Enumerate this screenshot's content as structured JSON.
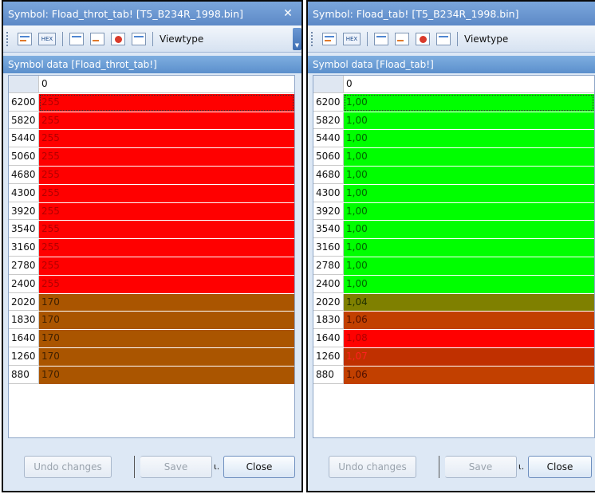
{
  "left": {
    "title": "Symbol: Fload_throt_tab! [T5_B234R_1998.bin]",
    "close_glyph": "✕",
    "viewtype_label": "Viewtype",
    "panel_header": "Symbol data [Fload_throt_tab!]",
    "column_header": "0",
    "rows": [
      {
        "label": "6200",
        "value": "255",
        "bg": "#ff0000",
        "fg": "#b30000"
      },
      {
        "label": "5820",
        "value": "255",
        "bg": "#ff0000",
        "fg": "#b30000"
      },
      {
        "label": "5440",
        "value": "255",
        "bg": "#ff0000",
        "fg": "#b30000"
      },
      {
        "label": "5060",
        "value": "255",
        "bg": "#ff0000",
        "fg": "#b30000"
      },
      {
        "label": "4680",
        "value": "255",
        "bg": "#ff0000",
        "fg": "#b30000"
      },
      {
        "label": "4300",
        "value": "255",
        "bg": "#ff0000",
        "fg": "#b30000"
      },
      {
        "label": "3920",
        "value": "255",
        "bg": "#ff0000",
        "fg": "#b30000"
      },
      {
        "label": "3540",
        "value": "255",
        "bg": "#ff0000",
        "fg": "#b30000"
      },
      {
        "label": "3160",
        "value": "255",
        "bg": "#ff0000",
        "fg": "#b30000"
      },
      {
        "label": "2780",
        "value": "255",
        "bg": "#ff0000",
        "fg": "#b30000"
      },
      {
        "label": "2400",
        "value": "255",
        "bg": "#ff0000",
        "fg": "#b30000"
      },
      {
        "label": "2020",
        "value": "170",
        "bg": "#aa5500",
        "fg": "#402000"
      },
      {
        "label": "1830",
        "value": "170",
        "bg": "#aa5500",
        "fg": "#402000"
      },
      {
        "label": "1640",
        "value": "170",
        "bg": "#aa5500",
        "fg": "#402000"
      },
      {
        "label": "1260",
        "value": "170",
        "bg": "#aa5500",
        "fg": "#402000"
      },
      {
        "label": "880",
        "value": "170",
        "bg": "#aa5500",
        "fg": "#402000"
      }
    ],
    "buttons": {
      "undo": "Undo changes",
      "save": "Save",
      "frag": "ɩ.",
      "close": "Close"
    }
  },
  "right": {
    "title": "Symbol: Fload_tab! [T5_B234R_1998.bin]",
    "viewtype_label": "Viewtype",
    "panel_header": "Symbol data [Fload_tab!]",
    "column_header": "0",
    "rows": [
      {
        "label": "6200",
        "value": "1,00",
        "bg": "#00ff00",
        "fg": "#006600"
      },
      {
        "label": "5820",
        "value": "1,00",
        "bg": "#00ff00",
        "fg": "#006600"
      },
      {
        "label": "5440",
        "value": "1,00",
        "bg": "#00ff00",
        "fg": "#006600"
      },
      {
        "label": "5060",
        "value": "1,00",
        "bg": "#00ff00",
        "fg": "#006600"
      },
      {
        "label": "4680",
        "value": "1,00",
        "bg": "#00ff00",
        "fg": "#006600"
      },
      {
        "label": "4300",
        "value": "1,00",
        "bg": "#00ff00",
        "fg": "#006600"
      },
      {
        "label": "3920",
        "value": "1,00",
        "bg": "#00ff00",
        "fg": "#006600"
      },
      {
        "label": "3540",
        "value": "1,00",
        "bg": "#00ff00",
        "fg": "#006600"
      },
      {
        "label": "3160",
        "value": "1,00",
        "bg": "#00ff00",
        "fg": "#006600"
      },
      {
        "label": "2780",
        "value": "1,00",
        "bg": "#00ff00",
        "fg": "#006600"
      },
      {
        "label": "2400",
        "value": "1,00",
        "bg": "#00ff00",
        "fg": "#006600"
      },
      {
        "label": "2020",
        "value": "1,04",
        "bg": "#7f8000",
        "fg": "#203000"
      },
      {
        "label": "1830",
        "value": "1,06",
        "bg": "#c24000",
        "fg": "#501000"
      },
      {
        "label": "1640",
        "value": "1,08",
        "bg": "#ff0000",
        "fg": "#b30000"
      },
      {
        "label": "1260",
        "value": "1,07",
        "bg": "#c03000",
        "fg": "#ff2020"
      },
      {
        "label": "880",
        "value": "1,06",
        "bg": "#c24000",
        "fg": "#501000"
      }
    ],
    "buttons": {
      "undo": "Undo changes",
      "save": "Save",
      "frag": "ɩ.",
      "close": "Close"
    }
  }
}
